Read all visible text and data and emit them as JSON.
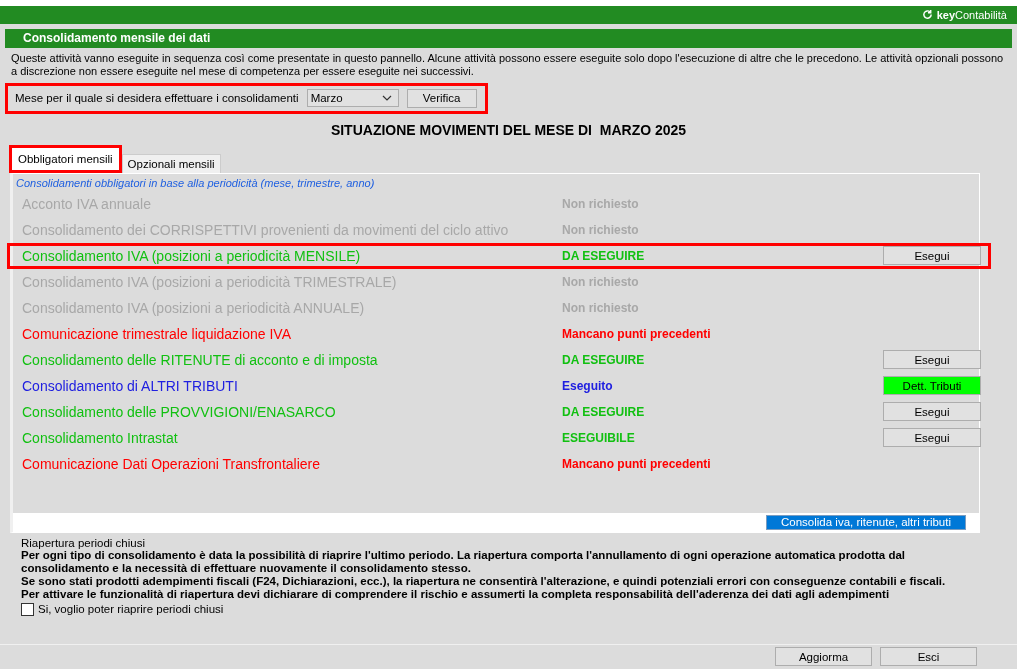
{
  "app_bar": {
    "logo_bold": "key",
    "logo_text": "Contabilità"
  },
  "panel": {
    "title": "Consolidamento mensile dei dati",
    "description": "Queste attività vanno eseguite in sequenza così come presentate in questo pannello. Alcune attività possono essere eseguite solo dopo l'esecuzione di altre che le precedono. Le attività opzionali possono a discrezione non essere eseguite nel mese di competenza per essere eseguite nei successivi.",
    "month_bar": {
      "highlighted": true,
      "label": "Mese per il quale si desidera effettuare i consolidamenti",
      "month": "Marzo",
      "button": "Verifica"
    },
    "heading": "SITUAZIONE MOVIMENTI DEL MESE DI  MARZO 2025",
    "tabs": [
      {
        "label": "Obbligatori mensili",
        "selected": true,
        "highlighted": true
      },
      {
        "label": "Opzionali mensili",
        "selected": false,
        "highlighted": false
      }
    ],
    "section_caption": "Consolidamenti obbligatori in base alla periodicità (mese, trimestre, anno)",
    "rows": [
      {
        "name": "Acconto IVA annuale",
        "status": "Non richiesto",
        "kind": "not_required",
        "highlighted": false
      },
      {
        "name": "Consolidamento dei CORRISPETTIVI provenienti da movimenti del ciclo attivo",
        "status": "Non richiesto",
        "kind": "not_required",
        "highlighted": false
      },
      {
        "name": "Consolidamento IVA (posizioni a periodicità MENSILE)",
        "status": "DA ESEGUIRE",
        "kind": "to_do",
        "highlighted": true,
        "button": {
          "label": "Esegui",
          "kind": "plain"
        }
      },
      {
        "name": "Consolidamento IVA (posizioni a periodicità TRIMESTRALE)",
        "status": "Non richiesto",
        "kind": "not_required",
        "highlighted": false
      },
      {
        "name": "Consolidamento IVA (posizioni a periodicità ANNUALE)",
        "status": "Non richiesto",
        "kind": "not_required",
        "highlighted": false
      },
      {
        "name": "Comunicazione trimestrale liquidazione IVA",
        "status": "Mancano punti precedenti",
        "kind": "blocked",
        "highlighted": false
      },
      {
        "name": "Consolidamento delle RITENUTE di acconto e di imposta",
        "status": "DA ESEGUIRE",
        "kind": "to_do",
        "highlighted": false,
        "button": {
          "label": "Esegui",
          "kind": "plain"
        }
      },
      {
        "name": "Consolidamento di ALTRI TRIBUTI",
        "status": "Eseguito",
        "kind": "done",
        "highlighted": false,
        "button": {
          "label": "Dett. Tributi",
          "kind": "green"
        }
      },
      {
        "name": "Consolidamento delle PROVVIGIONI/ENASARCO",
        "status": "DA ESEGUIRE",
        "kind": "to_do",
        "highlighted": false,
        "button": {
          "label": "Esegui",
          "kind": "plain"
        }
      },
      {
        "name": "Consolidamento Intrastat",
        "status": "ESEGUIBILE",
        "kind": "to_do",
        "highlighted": false,
        "button": {
          "label": "Esegui",
          "kind": "plain"
        }
      },
      {
        "name": "Comunicazione Dati Operazioni Transfrontaliere",
        "status": "Mancano punti precedenti",
        "kind": "blocked",
        "highlighted": false
      }
    ],
    "consolidate_button": "Consolida iva, ritenute, altri tributi",
    "reopen": {
      "title": "Riapertura periodi chiusi",
      "paragraphs": [
        "Per ogni tipo di consolidamento è data la possibilità di riaprire l'ultimo periodo. La riapertura comporta l'annullamento di ogni operazione automatica prodotta dal consolidamento e la necessità di effettuare nuovamente il consolidamento stesso.",
        "Se sono stati prodotti adempimenti fiscali (F24, Dichiarazioni, ecc.), la riapertura ne consentirà l'alterazione, e quindi potenziali errori con conseguenze contabili e fiscali. Per attivare le funzionalità di riapertura devi dichiarare di comprendere il rischio e assumerti la completa responsabilità dell'aderenza dei dati agli adempimenti"
      ],
      "checkbox": {
        "label": "Si, voglio poter riaprire periodi chiusi",
        "checked": false
      }
    }
  },
  "footer_buttons": [
    "Aggiorma",
    "Esci"
  ]
}
